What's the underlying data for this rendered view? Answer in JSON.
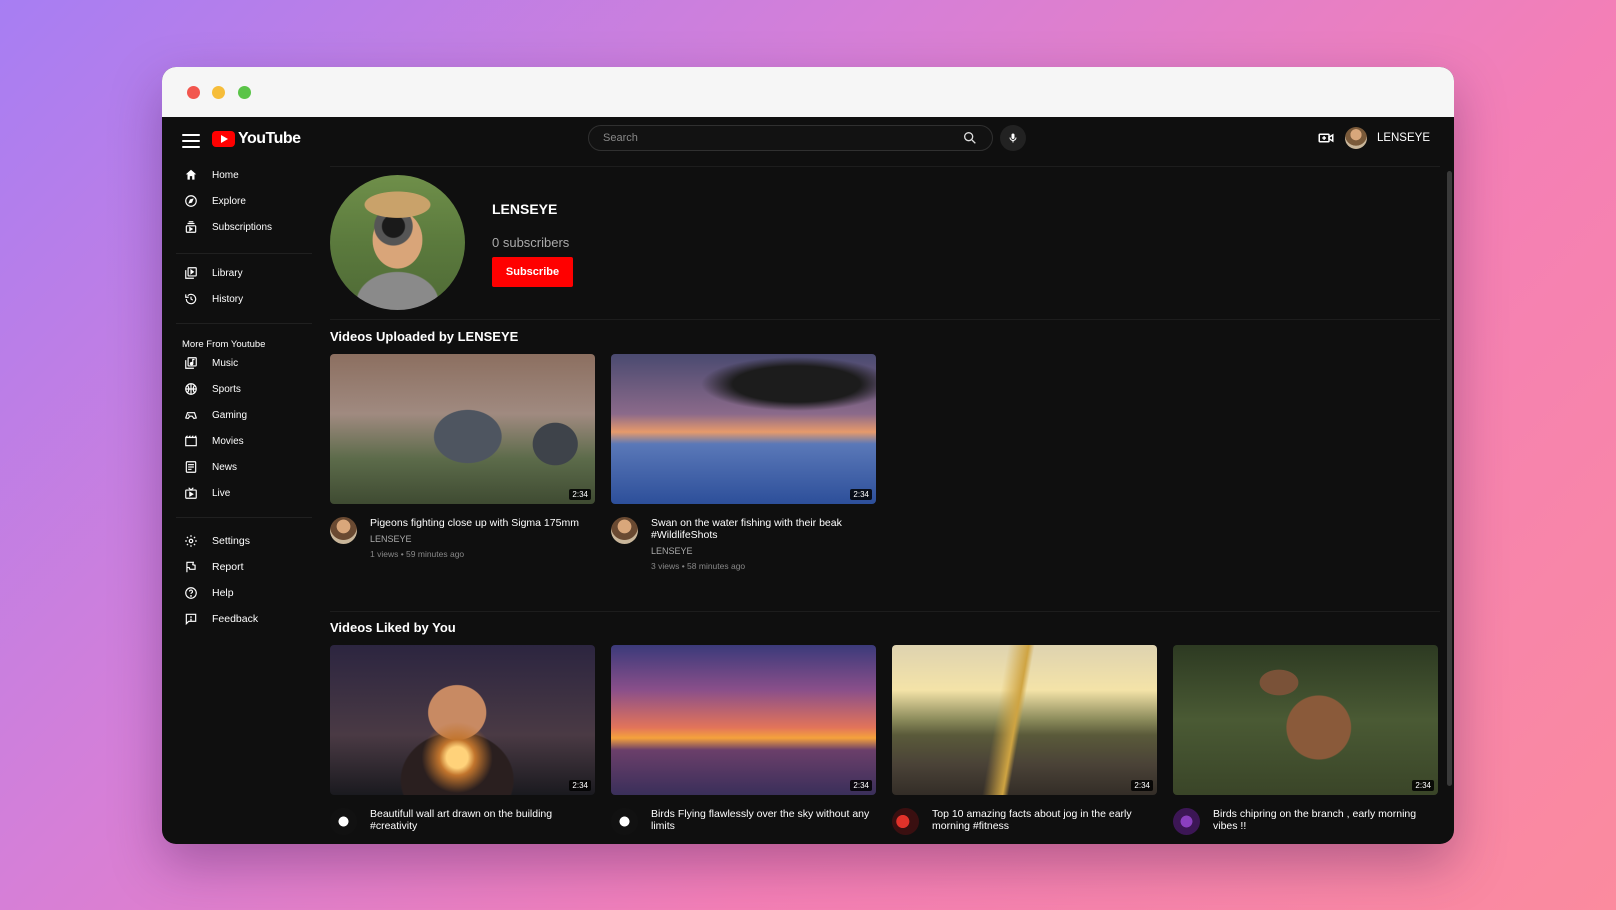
{
  "app": {
    "logo_text": "YouTube",
    "brand_color": "#ff0000"
  },
  "search": {
    "placeholder": "Search"
  },
  "user": {
    "name": "LENSEYE"
  },
  "sidebar": {
    "primary": [
      {
        "label": "Home",
        "icon": "home-icon"
      },
      {
        "label": "Explore",
        "icon": "compass-icon"
      },
      {
        "label": "Subscriptions",
        "icon": "subscriptions-icon"
      }
    ],
    "secondary": [
      {
        "label": "Library",
        "icon": "library-icon"
      },
      {
        "label": "History",
        "icon": "history-icon"
      }
    ],
    "more_heading": "More From Youtube",
    "more": [
      {
        "label": "Music",
        "icon": "music-icon"
      },
      {
        "label": "Sports",
        "icon": "sports-icon"
      },
      {
        "label": "Gaming",
        "icon": "gaming-icon"
      },
      {
        "label": "Movies",
        "icon": "movies-icon"
      },
      {
        "label": "News",
        "icon": "news-icon"
      },
      {
        "label": "Live",
        "icon": "live-icon"
      }
    ],
    "footer": [
      {
        "label": "Settings",
        "icon": "gear-icon"
      },
      {
        "label": "Report",
        "icon": "flag-icon"
      },
      {
        "label": "Help",
        "icon": "help-icon"
      },
      {
        "label": "Feedback",
        "icon": "feedback-icon"
      }
    ]
  },
  "channel": {
    "name": "LENSEYE",
    "subscribers": "0 subscribers",
    "subscribe_label": "Subscribe"
  },
  "uploaded": {
    "title": "Videos Uploaded by LENSEYE",
    "videos": [
      {
        "title": "Pigeons fighting close up with Sigma 175mm",
        "channel": "LENSEYE",
        "stats": "1 views • 59 minutes ago",
        "duration": "2:34"
      },
      {
        "title": "Swan on the water fishing with their beak #WildlifeShots",
        "channel": "LENSEYE",
        "stats": "3 views • 58 minutes ago",
        "duration": "2:34"
      }
    ]
  },
  "liked": {
    "title": "Videos Liked by You",
    "videos": [
      {
        "title": "Beautifull wall art drawn on the building #creativity",
        "duration": "2:34"
      },
      {
        "title": "Birds Flying flawlessly over the sky without any limits",
        "duration": "2:34"
      },
      {
        "title": "Top 10 amazing facts about jog in the early morning #fitness",
        "duration": "2:34"
      },
      {
        "title": "Birds chipring on the branch , early morning vibes !!",
        "duration": "2:34"
      }
    ]
  }
}
